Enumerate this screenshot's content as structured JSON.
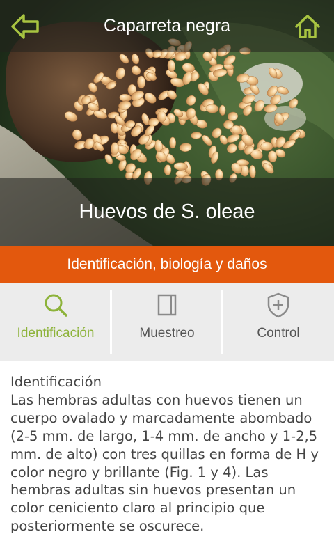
{
  "header": {
    "title": "Caparreta negra",
    "back_icon": "back-arrow-icon",
    "home_icon": "home-icon",
    "icon_color": "#a8c441"
  },
  "hero": {
    "caption": "Huevos de S. oleae"
  },
  "section": {
    "title": "Identificación, biología y daños",
    "color": "#e3580d"
  },
  "tabs": [
    {
      "label": "Identificación",
      "icon": "magnifier-icon",
      "active": true
    },
    {
      "label": "Muestreo",
      "icon": "notebook-icon",
      "active": false
    },
    {
      "label": "Control",
      "icon": "shield-plus-icon",
      "active": false
    }
  ],
  "tab_active_color": "#8db33a",
  "content": {
    "heading": "Identificación",
    "body": "Las hembras adultas con huevos tienen un cuerpo ovalado y marcadamente abombado (2-5 mm. de largo, 1-4 mm. de ancho y 1-2,5 mm. de alto) con tres quillas en forma de H y color negro y brillante (Fig. 1 y 4). Las hembras adultas sin huevos presentan un color ceniciento claro al principio que posteriormente se oscurece."
  }
}
